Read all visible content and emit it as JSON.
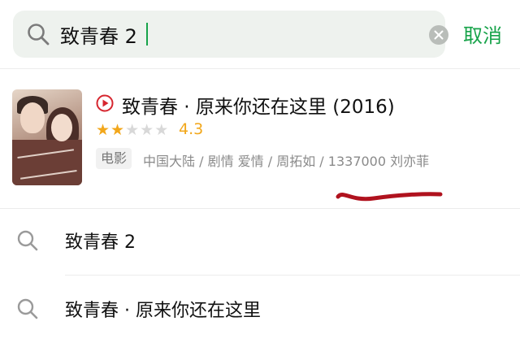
{
  "search": {
    "value": "致青春 2",
    "cancel_label": "取消"
  },
  "movie_result": {
    "title": "致青春 · 原来你还在这里 (2016)",
    "rating": "4.3",
    "stars_filled": 2,
    "stars_total": 5,
    "type_tag": "电影",
    "meta": "中国大陆 / 剧情 爱情 / 周拓如 / 1337000 刘亦菲"
  },
  "suggestions": [
    {
      "label": "致青春 2"
    },
    {
      "label": "致青春 · 原来你还在这里"
    }
  ],
  "colors": {
    "accent": "#17a34a",
    "star": "#f2a71b",
    "annotation": "#b0121e"
  }
}
